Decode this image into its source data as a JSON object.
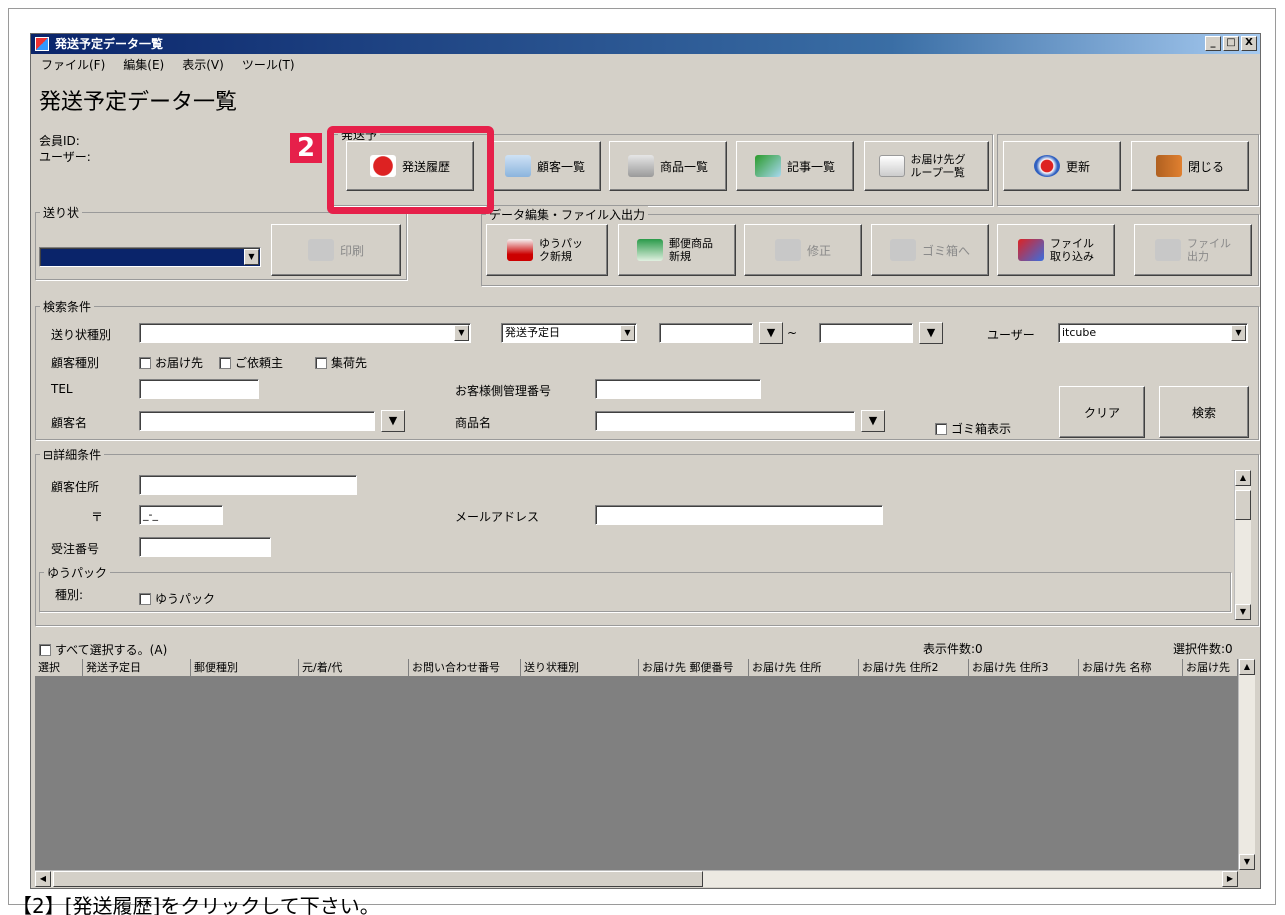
{
  "window": {
    "title": "発送予定データ一覧",
    "controls": [
      "_",
      "□",
      "X"
    ]
  },
  "menu": [
    "ファイル(F)",
    "編集(E)",
    "表示(V)",
    "ツール(T)"
  ],
  "page_title": "発送予定データ一覧",
  "member_id_label": "会員ID:",
  "user_label": "ユーザー:",
  "main_group_label": "発送予",
  "toolbar": {
    "history": "発送履歴",
    "customers": "顧客一覧",
    "products": "商品一覧",
    "articles": "記事一覧",
    "delivery_groups": "お届け先グループ一覧",
    "refresh": "更新",
    "close": "閉じる"
  },
  "label_group": {
    "label": "送り状",
    "print": "印刷"
  },
  "data_group": {
    "label": "データ編集・ファイル入出力",
    "yupack_new": "ゆうパック新規",
    "postal_new": "郵便商品新規",
    "edit": "修正",
    "trash": "ゴミ箱へ",
    "import": "ファイル取り込み",
    "export": "ファイル出力"
  },
  "search": {
    "label": "検索条件",
    "label_type": "送り状種別",
    "date_type": "発送予定日",
    "tilde": "~",
    "user": "ユーザー",
    "user_value": "itcube",
    "customer_type": "顧客種別",
    "chk_delivery": "お届け先",
    "chk_client": "ご依頼主",
    "chk_pickup": "集荷先",
    "tel": "TEL",
    "mgmt_no": "お客様側管理番号",
    "customer_name": "顧客名",
    "product_name": "商品名",
    "show_trash": "ゴミ箱表示",
    "clear": "クリア",
    "search": "検索"
  },
  "detail": {
    "label": "詳細条件",
    "address": "顧客住所",
    "zip_mark": "〒",
    "zip_value": "_-_",
    "email": "メールアドレス",
    "order_no": "受注番号",
    "yupack_group": "ゆうパック",
    "kind": "種別:",
    "chk_yupack": "ゆうパック"
  },
  "list": {
    "select_all": "すべて選択する。(A)",
    "display_count": "表示件数:0",
    "selected_count": "選択件数:0",
    "columns": [
      "選択",
      "発送予定日",
      "郵便種別",
      "元/着/代",
      "お問い合わせ番号",
      "送り状種別",
      "お届け先 郵便番号",
      "お届け先 住所",
      "お届け先 住所2",
      "お届け先 住所3",
      "お届け先 名称",
      "お届け先"
    ]
  },
  "annotation": {
    "step": "2",
    "caption": "【2】[発送履歴]をクリックして下さい。"
  }
}
